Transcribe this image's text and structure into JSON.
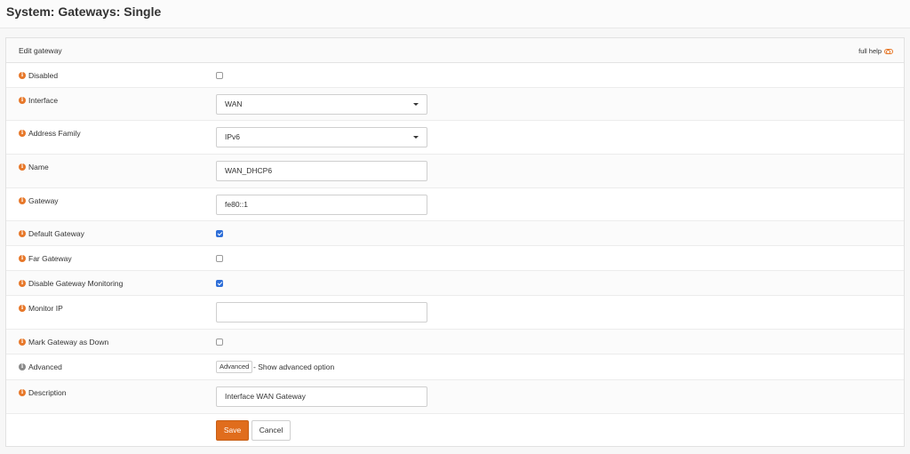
{
  "page": {
    "title": "System: Gateways: Single"
  },
  "panel": {
    "title": "Edit gateway",
    "full_help": "full help"
  },
  "fields": {
    "disabled": {
      "label": "Disabled",
      "checked": false
    },
    "interface": {
      "label": "Interface",
      "value": "WAN"
    },
    "address_family": {
      "label": "Address Family",
      "value": "IPv6"
    },
    "name": {
      "label": "Name",
      "value": "WAN_DHCP6"
    },
    "gateway": {
      "label": "Gateway",
      "value": "fe80::1"
    },
    "default_gateway": {
      "label": "Default Gateway",
      "checked": true
    },
    "far_gateway": {
      "label": "Far Gateway",
      "checked": false
    },
    "disable_monitoring": {
      "label": "Disable Gateway Monitoring",
      "checked": true
    },
    "monitor_ip": {
      "label": "Monitor IP",
      "value": ""
    },
    "mark_down": {
      "label": "Mark Gateway as Down",
      "checked": false
    },
    "advanced": {
      "label": "Advanced",
      "button": "Advanced",
      "text": "- Show advanced option"
    },
    "description": {
      "label": "Description",
      "value": "Interface WAN Gateway"
    }
  },
  "actions": {
    "save": "Save",
    "cancel": "Cancel"
  },
  "colors": {
    "accent": "#e06d1d",
    "info_icon": "#e7782a",
    "checkbox_checked": "#2f6fd8"
  },
  "icons": {
    "info": "info-circle-icon",
    "help_toggle": "toggle-icon",
    "dropdown": "caret-down-icon"
  }
}
